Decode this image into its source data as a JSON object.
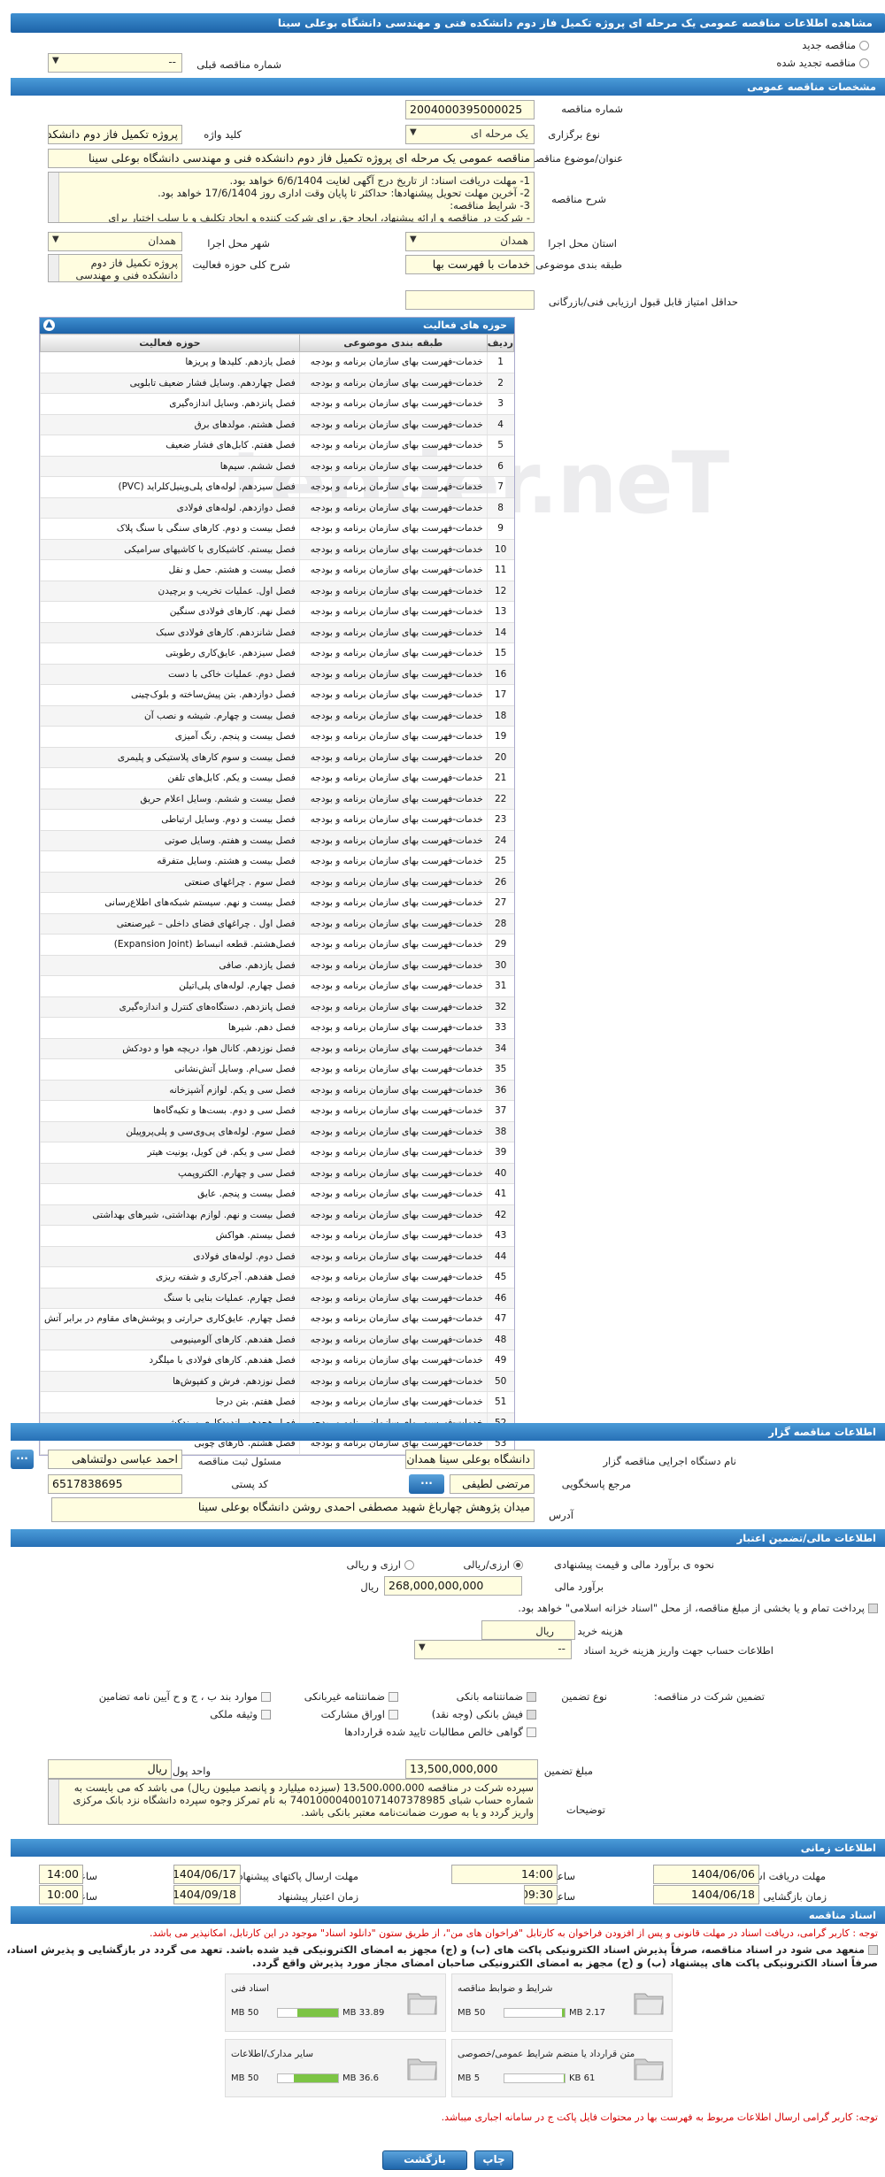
{
  "title": "مشاهده اطلاعات مناقصه عمومی یک مرحله ای پروژه تکمیل فاز دوم دانشکده فنی و مهندسی دانشگاه بوعلی سینا",
  "tender_type": {
    "new": "مناقصه جدید",
    "renewed": "مناقصه تجدید شده",
    "prev_label": "شماره مناقصه قبلی",
    "prev_value": "--"
  },
  "sections": {
    "general": "مشخصات مناقصه عمومی",
    "organizer": "اطلاعات مناقصه گزار",
    "financial": "اطلاعات مالی/تضمین اعتبار",
    "timing": "اطلاعات زمانی",
    "docs": "اسناد مناقصه"
  },
  "general": {
    "number_label": "شماره مناقصه",
    "number": "2004000395000025",
    "type_label": "نوع برگزاری",
    "type": "یک مرحله ای",
    "keyword_label": "کلید واژه",
    "keyword": "پروژه تکمیل فاز دوم دانشکده",
    "subject_label": "عنوان/موضوع مناقصه",
    "subject": "مناقصه عمومی یک مرحله ای پروژه تکمیل فاز دوم دانشکده فنی و مهندسی دانشگاه بوعلی سینا",
    "desc_label": "شرح مناقصه",
    "desc_lines": [
      "1- مهلت دریافت اسناد: از تاریخ درج آگهی لغایت 6/6/1404 خواهد بود.",
      "2- آخرین مهلت تحویل پیشنهادها: حداکثر تا پایان وقت اداری روز 17/6/1404 خواهد بود.",
      "3- شرایط مناقصه:",
      "- شرکت در مناقصه و ارائه پیشنهاد، ایجاد حق برای شرکت کننده و ایجاد تکلیف و یا سلب اختیار برای"
    ],
    "province_label": "استان محل اجرا",
    "province": "همدان",
    "city_label": "شهر محل اجرا",
    "city": "همدان",
    "category_label": "طبقه بندی موضوعی",
    "category": "خدمات با فهرست بها",
    "scope_label": "شرح کلی حوزه فعالیت",
    "scope": "پروژه تکمیل فاز دوم دانشکده فنی و مهندسی",
    "min_score_label": "حداقل امتیاز قابل قبول ارزیابی فنی/بازرگانی",
    "min_score": ""
  },
  "activities": {
    "title": "حوزه های فعالیت",
    "headers": [
      "ردیف",
      "طبقه بندی موضوعی",
      "حوزه فعالیت"
    ],
    "rows": [
      [
        "1",
        "خدمات-فهرست بهای سازمان برنامه و بودجه",
        "فصل یازدهم. کلیدها و پریزها"
      ],
      [
        "2",
        "خدمات-فهرست بهای سازمان برنامه و بودجه",
        "فصل چهاردهم. وسایل فشار ضعیف تابلویی"
      ],
      [
        "3",
        "خدمات-فهرست بهای سازمان برنامه و بودجه",
        "فصل پانزدهم. وسایل اندازه‌گیری"
      ],
      [
        "4",
        "خدمات-فهرست بهای سازمان برنامه و بودجه",
        "فصل هشتم. مولدهای برق"
      ],
      [
        "5",
        "خدمات-فهرست بهای سازمان برنامه و بودجه",
        "فصل هفتم. کابل‌های فشار ضعیف"
      ],
      [
        "6",
        "خدمات-فهرست بهای سازمان برنامه و بودجه",
        "فصل ششم. سیم‌ها"
      ],
      [
        "7",
        "خدمات-فهرست بهای سازمان برنامه و بودجه",
        "فصل سیزدهم. لوله‌های پلی‌وینیل‌کلراید (PVC)"
      ],
      [
        "8",
        "خدمات-فهرست بهای سازمان برنامه و بودجه",
        "فصل دوازدهم. لوله‌های فولادی"
      ],
      [
        "9",
        "خدمات-فهرست بهای سازمان برنامه و بودجه",
        "فصل بیست و دوم. کارهای سنگی با سنگ پلاک"
      ],
      [
        "10",
        "خدمات-فهرست بهای سازمان برنامه و بودجه",
        "فصل بیستم. کاشیکاری با کاشیهای سرامیکی"
      ],
      [
        "11",
        "خدمات-فهرست بهای سازمان برنامه و بودجه",
        "فصل بیست و هشتم. حمل و نقل"
      ],
      [
        "12",
        "خدمات-فهرست بهای سازمان برنامه و بودجه",
        "فصل اول. عملیات تخریب و برچیدن"
      ],
      [
        "13",
        "خدمات-فهرست بهای سازمان برنامه و بودجه",
        "فصل نهم. کارهای فولادی سنگین"
      ],
      [
        "14",
        "خدمات-فهرست بهای سازمان برنامه و بودجه",
        "فصل شانزدهم. کارهای فولادی سبک"
      ],
      [
        "15",
        "خدمات-فهرست بهای سازمان برنامه و بودجه",
        "فصل سیزدهم. عایق‌کاری رطوبتی"
      ],
      [
        "16",
        "خدمات-فهرست بهای سازمان برنامه و بودجه",
        "فصل دوم. عملیات خاکی با دست"
      ],
      [
        "17",
        "خدمات-فهرست بهای سازمان برنامه و بودجه",
        "فصل دوازدهم. بتن پیش‌ساخته و بلوک‌چینی"
      ],
      [
        "18",
        "خدمات-فهرست بهای سازمان برنامه و بودجه",
        "فصل بیست و چهارم. شیشه و نصب آن"
      ],
      [
        "19",
        "خدمات-فهرست بهای سازمان برنامه و بودجه",
        "فصل بیست و پنجم. رنگ آمیزی"
      ],
      [
        "20",
        "خدمات-فهرست بهای سازمان برنامه و بودجه",
        "فصل بیست و سوم کارهای پلاستیکی و پلیمری"
      ],
      [
        "21",
        "خدمات-فهرست بهای سازمان برنامه و بودجه",
        "فصل بیست و یکم. کابل‌های تلفن"
      ],
      [
        "22",
        "خدمات-فهرست بهای سازمان برنامه و بودجه",
        "فصل بیست و ششم. وسایل اعلام حریق"
      ],
      [
        "23",
        "خدمات-فهرست بهای سازمان برنامه و بودجه",
        "فصل بیست و دوم. وسایل ارتباطی"
      ],
      [
        "24",
        "خدمات-فهرست بهای سازمان برنامه و بودجه",
        "فصل بیست و هفتم. وسایل صوتی"
      ],
      [
        "25",
        "خدمات-فهرست بهای سازمان برنامه و بودجه",
        "فصل بیست و هشتم. وسایل متفرقه"
      ],
      [
        "26",
        "خدمات-فهرست بهای سازمان برنامه و بودجه",
        "فصل سوم . چراغهای صنعتی"
      ],
      [
        "27",
        "خدمات-فهرست بهای سازمان برنامه و بودجه",
        "فصل بیست و نهم. سیستم شبکه‌های اطلاع‌رسانی"
      ],
      [
        "28",
        "خدمات-فهرست بهای سازمان برنامه و بودجه",
        "فصل اول . چراغهای فضای داخلی – غیرصنعتی"
      ],
      [
        "29",
        "خدمات-فهرست بهای سازمان برنامه و بودجه",
        "فصل‌هشتم. قطعه انبساط (Expansion Joint)"
      ],
      [
        "30",
        "خدمات-فهرست بهای سازمان برنامه و بودجه",
        "فصل یازدهم. صافی"
      ],
      [
        "31",
        "خدمات-فهرست بهای سازمان برنامه و بودجه",
        "فصل چهارم. لوله‌های پلی‌اتیلن"
      ],
      [
        "32",
        "خدمات-فهرست بهای سازمان برنامه و بودجه",
        "فصل پانزدهم. دستگاه‌های کنترل و اندازه‌گیری"
      ],
      [
        "33",
        "خدمات-فهرست بهای سازمان برنامه و بودجه",
        "فصل دهم. شیرها"
      ],
      [
        "34",
        "خدمات-فهرست بهای سازمان برنامه و بودجه",
        "فصل نوزدهم. کانال هوا، دریچه هوا و دودکش"
      ],
      [
        "35",
        "خدمات-فهرست بهای سازمان برنامه و بودجه",
        "فصل سی‌ام. وسایل آتش‌نشانی"
      ],
      [
        "36",
        "خدمات-فهرست بهای سازمان برنامه و بودجه",
        "فصل سی و یکم. لوازم آشپزخانه"
      ],
      [
        "37",
        "خدمات-فهرست بهای سازمان برنامه و بودجه",
        "فصل سی و دوم. بست‌ها و تکیه‌گاه‌ها"
      ],
      [
        "38",
        "خدمات-فهرست بهای سازمان برنامه و بودجه",
        "فصل سوم. لوله‌های پی‌وی‌سی و پلی‌پروپیلن"
      ],
      [
        "39",
        "خدمات-فهرست بهای سازمان برنامه و بودجه",
        "فصل سی و یکم. فن کویل، یونیت هیتر"
      ],
      [
        "40",
        "خدمات-فهرست بهای سازمان برنامه و بودجه",
        "فصل سی و چهارم. الکتروپمپ"
      ],
      [
        "41",
        "خدمات-فهرست بهای سازمان برنامه و بودجه",
        "فصل بیست و پنجم. عایق"
      ],
      [
        "42",
        "خدمات-فهرست بهای سازمان برنامه و بودجه",
        "فصل بیست و نهم. لوازم بهداشتی، شیرهای بهداشتی"
      ],
      [
        "43",
        "خدمات-فهرست بهای سازمان برنامه و بودجه",
        "فصل بیستم. هواکش"
      ],
      [
        "44",
        "خدمات-فهرست بهای سازمان برنامه و بودجه",
        "فصل دوم. لوله‌های فولادی"
      ],
      [
        "45",
        "خدمات-فهرست بهای سازمان برنامه و بودجه",
        "فصل هفدهم. آجرکاری و شفته ریزی"
      ],
      [
        "46",
        "خدمات-فهرست بهای سازمان برنامه و بودجه",
        "فصل چهارم. عملیات بنایی با سنگ"
      ],
      [
        "47",
        "خدمات-فهرست بهای سازمان برنامه و بودجه",
        "فصل چهارم. عایق‌کاری حرارتی و پوشش‌های مقاوم در برابر آتش"
      ],
      [
        "48",
        "خدمات-فهرست بهای سازمان برنامه و بودجه",
        "فصل هفدهم. کارهای آلومینیومی"
      ],
      [
        "49",
        "خدمات-فهرست بهای سازمان برنامه و بودجه",
        "فصل هفدهم. کارهای فولادی با میلگرد"
      ],
      [
        "50",
        "خدمات-فهرست بهای سازمان برنامه و بودجه",
        "فصل نوزدهم. فرش و کفپوش‌ها"
      ],
      [
        "51",
        "خدمات-فهرست بهای سازمان برنامه و بودجه",
        "فصل هفتم. بتن درجا"
      ],
      [
        "52",
        "خدمات-فهرست بهای سازمان برنامه و بودجه",
        "فصل هجدهم. اندودکاری و بندکشی"
      ],
      [
        "53",
        "خدمات-فهرست بهای سازمان برنامه و بودجه",
        "فصل هشتم. کارهای چوبی"
      ]
    ]
  },
  "organizer": {
    "device_label": "نام دستگاه اجرایی مناقصه گزار",
    "device": "دانشگاه بوعلی سینا همدان",
    "registrar_label": "مسئول ثبت مناقصه",
    "registrar": "احمد عباسی دولتشاهی",
    "ref_label": "مرجع پاسخگویی",
    "ref": "مرتضی لطیفی",
    "postal_label": "کد پستی",
    "postal": "6517838695",
    "address_label": "آدرس",
    "address": "میدان پژوهش چهارباغ شهید مصطفی احمدی روشن دانشگاه بوعلی سینا",
    "dots": "..."
  },
  "financial": {
    "estimate_label": "نحوه ی برآورد مالی و قیمت پیشنهادی",
    "opt_rial": "ارزی/ریالی",
    "opt_both": "ارزی و ریالی",
    "amount_label": "برآورد مالی",
    "amount": "268,000,000,000",
    "rial": "ریال",
    "payment_note": "پرداخت تمام و یا بخشی از مبلغ مناقصه، از محل \"اسناد خزانه اسلامی\" خواهد بود.",
    "doc_cost_label": "هزینه خرید اسناد",
    "doc_cost": "",
    "account_label": "اطلاعات حساب جهت واریز هزینه خرید اسناد",
    "account": "--",
    "guarantee_label": "تضمین شرکت در مناقصه:",
    "guarantee_type": "نوع تضمین",
    "g_items": [
      "ضمانتنامه بانکی",
      "ضمانتنامه غیربانکی",
      "موارد بند ب ، ج و ح آیین نامه تضامین",
      "فیش بانکی (وجه نقد)",
      "اوراق مشارکت",
      "وثیقه ملکی",
      "گواهی خالص مطالبات تایید شده قراردادها"
    ],
    "g_amount_label": "مبلغ تضمین",
    "g_amount": "13,500,000,000",
    "unit_label": "واحد پول",
    "unit": "ریال",
    "expl_label": "توضیحات",
    "explanation": "سپرده شرکت در مناقصه 13،500،000،000 (سیزده میلیارد و پانصد میلیون ریال) می باشد که می بایست به شماره حساب شبای 740100004001071407378985 به نام تمرکز وجوه سپرده دانشگاه نزد بانک مرکزی واریز گردد و یا به صورت ضمانت‌نامه معتبر بانکی باشد."
  },
  "timing": {
    "doc_recv_label": "مهلت دریافت اسناد",
    "doc_recv_date": "1404/06/06",
    "time_label": "ساعت",
    "doc_recv_time": "14:00",
    "submit_label": "مهلت ارسال پاکتهای پیشنهاد",
    "submit_date": "1404/06/17",
    "submit_time": "14:00",
    "open_label": "زمان بازگشایی پاکت ها",
    "open_date": "1404/06/18",
    "open_time": "09:30",
    "valid_label": "زمان اعتبار پیشنهاد",
    "valid_date": "1404/09/18",
    "valid_time": "10:00"
  },
  "docs": {
    "note1": "توجه : کاربر گرامی، دریافت اسناد در مهلت قانونی و پس از افزودن فراخوان به کارتابل \"فراخوان های من\"، از طریق ستون \"دانلود اسناد\" موجود در این کارتابل، امکانپذیر می باشد.",
    "note2": "منعهد می شود در اسناد مناقصه، صرفاً پذیرش اسناد الکترونیکی پاکت های (ب) و (ج) مجهز به امضای الکترونیکی قید شده باشد. تعهد می گردد در بازگشایی و پذیرش اسناد، صرفاً اسناد الکترونیکی پاکت های پیشنهاد (ب) و (ج) مجهز به امضای الکترونیکی صاحبان امضای مجاز مورد پذیرش واقع گردد.",
    "files": [
      {
        "name": "شرایط و ضوابط مناقصه",
        "used": "2.17 MB",
        "total": "50 MB",
        "pct": 0.05
      },
      {
        "name": "اسناد فنی",
        "used": "33.89 MB",
        "total": "50 MB",
        "pct": 0.68
      },
      {
        "name": "متن قرارداد یا منضم شرایط عمومی/خصوصی",
        "used": "61 KB",
        "total": "5 MB",
        "pct": 0.02
      },
      {
        "name": "سایر مدارک/اطلاعات",
        "used": "36.6 MB",
        "total": "50 MB",
        "pct": 0.73
      }
    ],
    "note3": "توجه: کاربر گرامی ارسال اطلاعات مربوط به فهرست بها در محتوات فایل پاکت ج در سامانه اجباری میباشد."
  },
  "buttons": {
    "back": "بازگشت",
    "print": "چاپ"
  }
}
